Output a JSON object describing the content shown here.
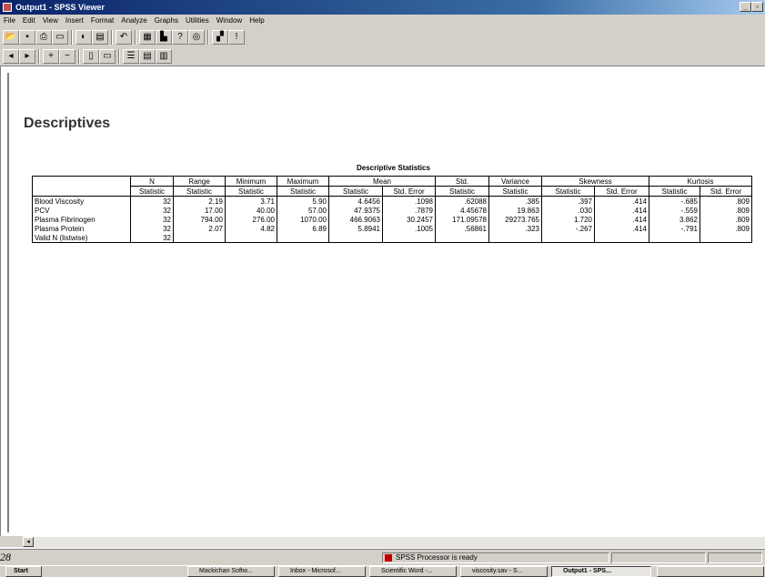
{
  "window": {
    "title": "Output1 - SPSS Viewer"
  },
  "menu": [
    "File",
    "Edit",
    "View",
    "Insert",
    "Format",
    "Analyze",
    "Graphs",
    "Utilities",
    "Window",
    "Help"
  ],
  "heading": "Descriptives",
  "table": {
    "title": "Descriptive Statistics",
    "group_headers": {
      "n": "N",
      "range": "Range",
      "minimum": "Minimum",
      "maximum": "Maximum",
      "mean": "Mean",
      "std": "Std.",
      "variance": "Variance",
      "skewness": "Skewness",
      "kurtosis": "Kurtosis"
    },
    "sub_headers": [
      "Statistic",
      "Statistic",
      "Statistic",
      "Statistic",
      "Statistic",
      "Std. Error",
      "Statistic",
      "Statistic",
      "Statistic",
      "Std. Error",
      "Statistic",
      "Std. Error"
    ],
    "rows": [
      {
        "label": "Blood Viscosity",
        "values": [
          "32",
          "2.19",
          "3.71",
          "5.90",
          "4.6456",
          ".1098",
          ".62088",
          ".385",
          ".397",
          ".414",
          "-.685",
          ".809"
        ]
      },
      {
        "label": "PCV",
        "values": [
          "32",
          "17.00",
          "40.00",
          "57.00",
          "47.9375",
          ".7879",
          "4.45678",
          "19.863",
          ".030",
          ".414",
          "-.559",
          ".809"
        ]
      },
      {
        "label": "Plasma Fibrinogen",
        "values": [
          "32",
          "794.00",
          "276.00",
          "1070.00",
          "466.9063",
          "30.2457",
          "171.09578",
          "29273.765",
          "1.720",
          ".414",
          "3.862",
          ".809"
        ]
      },
      {
        "label": "Plasma Protein",
        "values": [
          "32",
          "2.07",
          "4.82",
          "6.89",
          "5.8941",
          ".1005",
          ".56861",
          ".323",
          "-.267",
          ".414",
          "-.791",
          ".809"
        ]
      },
      {
        "label": "Valid N (listwise)",
        "values": [
          "32",
          "",
          "",
          "",
          "",
          "",
          "",
          "",
          "",
          "",
          "",
          ""
        ]
      }
    ]
  },
  "status": {
    "text": "SPSS Processor  is ready"
  },
  "page_number": "28",
  "taskbar": {
    "start": "Start",
    "tasks": [
      "Mackichan Softw...",
      "Inbox - Microsof...",
      "Scientific Word -...",
      "viscosity.sav - S...",
      "Output1 - SPS..."
    ]
  },
  "icons": {
    "toolbar1": [
      "open-icon",
      "save-icon",
      "print-icon",
      "print-preview-icon",
      "export-icon",
      "recall-dialog-icon",
      "undo-icon",
      "goto-data-icon",
      "goto-chart-icon",
      "variables-icon",
      "find-icon",
      "designate-window-icon",
      "info-icon"
    ],
    "toolbar2": [
      "promote-icon",
      "demote-icon",
      "expand-icon",
      "collapse-icon",
      "show-icon",
      "hide-icon",
      "insert-heading-icon",
      "insert-title-icon",
      "insert-text-icon"
    ]
  }
}
